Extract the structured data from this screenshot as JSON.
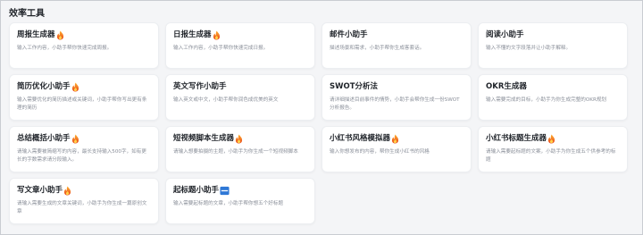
{
  "section": {
    "title": "效率工具"
  },
  "cards": [
    {
      "title": "周报生成器",
      "icon": "fire-icon",
      "desc": "输入工作内容，小助手帮你快速完成周报。"
    },
    {
      "title": "日报生成器",
      "icon": "fire-icon",
      "desc": "输入工作内容，小助手帮你快速完成日报。"
    },
    {
      "title": "邮件小助手",
      "icon": "",
      "desc": "描述场景和需求，小助手帮你生成客套话。"
    },
    {
      "title": "阅读小助手",
      "icon": "",
      "desc": "输入不懂的文字段落并让小助手解释。"
    },
    {
      "title": "简历优化小助手",
      "icon": "fire-icon",
      "desc": "输入需要优化的简历描述或关键词，小助手帮你写出更有条理的简历"
    },
    {
      "title": "英文写作小助手",
      "icon": "",
      "desc": "输入英文或中文，小助手帮你润色成优美的英文"
    },
    {
      "title": "SWOT分析法",
      "icon": "",
      "desc": "请详细描述目前事件的情势，小助手会帮你生成一份SWOT分析报告。"
    },
    {
      "title": "OKR生成器",
      "icon": "",
      "desc": "输入需要完成的目标，小助手为你生成完整的OKR规划"
    },
    {
      "title": "总结概括小助手",
      "icon": "fire-icon",
      "desc": "请输入需要被简缩写的内容，最长支持输入500字，如有更长的字数需求请分段输入。"
    },
    {
      "title": "短视频脚本生成器",
      "icon": "fire-icon",
      "desc": "请输入想要拍摄的主题，小助手为你生成一个短视频脚本"
    },
    {
      "title": "小红书风格模拟器",
      "icon": "fire-icon",
      "desc": "输入你想发布的内容，帮你生成小红书的风格"
    },
    {
      "title": "小红书标题生成器",
      "icon": "fire-icon",
      "desc": "请输入需要起标题的文案，小助手为你生成五个供参考的标题"
    },
    {
      "title": "写文章小助手",
      "icon": "fire-icon",
      "desc": "请输入需要生成的文章关键词，小助手为你生成一篇原创文章"
    },
    {
      "title": "起标题小助手",
      "icon": "new-icon",
      "desc": "输入需要起标题的文章，小助手帮你想五个好标题"
    }
  ],
  "colors": {
    "fire": "#f0702a",
    "new": "#2f78d6"
  }
}
